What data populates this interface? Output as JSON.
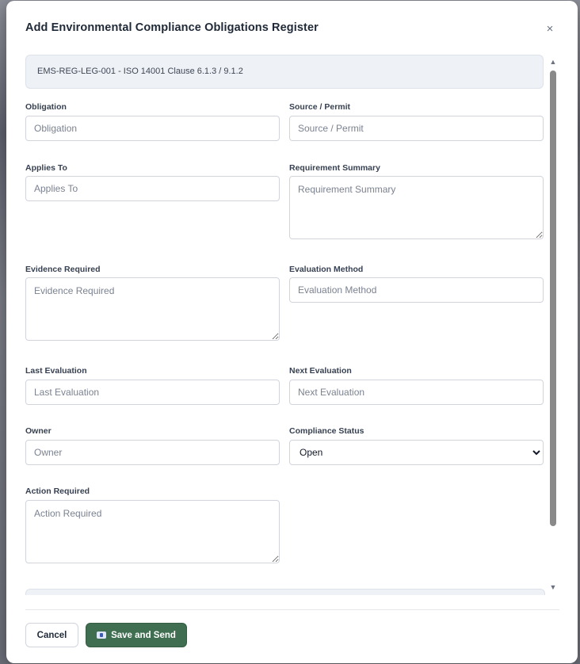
{
  "dialog": {
    "title": "Add Environmental Compliance Obligations Register",
    "close_label": "×"
  },
  "reference": "EMS-REG-LEG-001 - ISO 14001 Clause 6.1.3 / 9.1.2",
  "fields": {
    "obligation": {
      "label": "Obligation",
      "placeholder": "Obligation",
      "value": ""
    },
    "source_permit": {
      "label": "Source / Permit",
      "placeholder": "Source / Permit",
      "value": ""
    },
    "applies_to": {
      "label": "Applies To",
      "placeholder": "Applies To",
      "value": ""
    },
    "requirement_summary": {
      "label": "Requirement Summary",
      "placeholder": "Requirement Summary",
      "value": ""
    },
    "evidence_required": {
      "label": "Evidence Required",
      "placeholder": "Evidence Required",
      "value": ""
    },
    "evaluation_method": {
      "label": "Evaluation Method",
      "placeholder": "Evaluation Method",
      "value": ""
    },
    "last_evaluation": {
      "label": "Last Evaluation",
      "placeholder": "Last Evaluation",
      "value": ""
    },
    "next_evaluation": {
      "label": "Next Evaluation",
      "placeholder": "Next Evaluation",
      "value": ""
    },
    "owner": {
      "label": "Owner",
      "placeholder": "Owner",
      "value": ""
    },
    "compliance_status": {
      "label": "Compliance Status",
      "selected": "Open"
    },
    "action_required": {
      "label": "Action Required",
      "placeholder": "Action Required",
      "value": ""
    }
  },
  "footer": {
    "cancel_label": "Cancel",
    "save_label": "Save and Send"
  },
  "icons": {
    "close": "close-icon",
    "save": "envelope-icon",
    "scroll_up": "arrow-up-icon",
    "scroll_down": "arrow-down-icon"
  },
  "colors": {
    "primary_button": "#3f6e50",
    "banner_bg": "#eef1f6"
  }
}
